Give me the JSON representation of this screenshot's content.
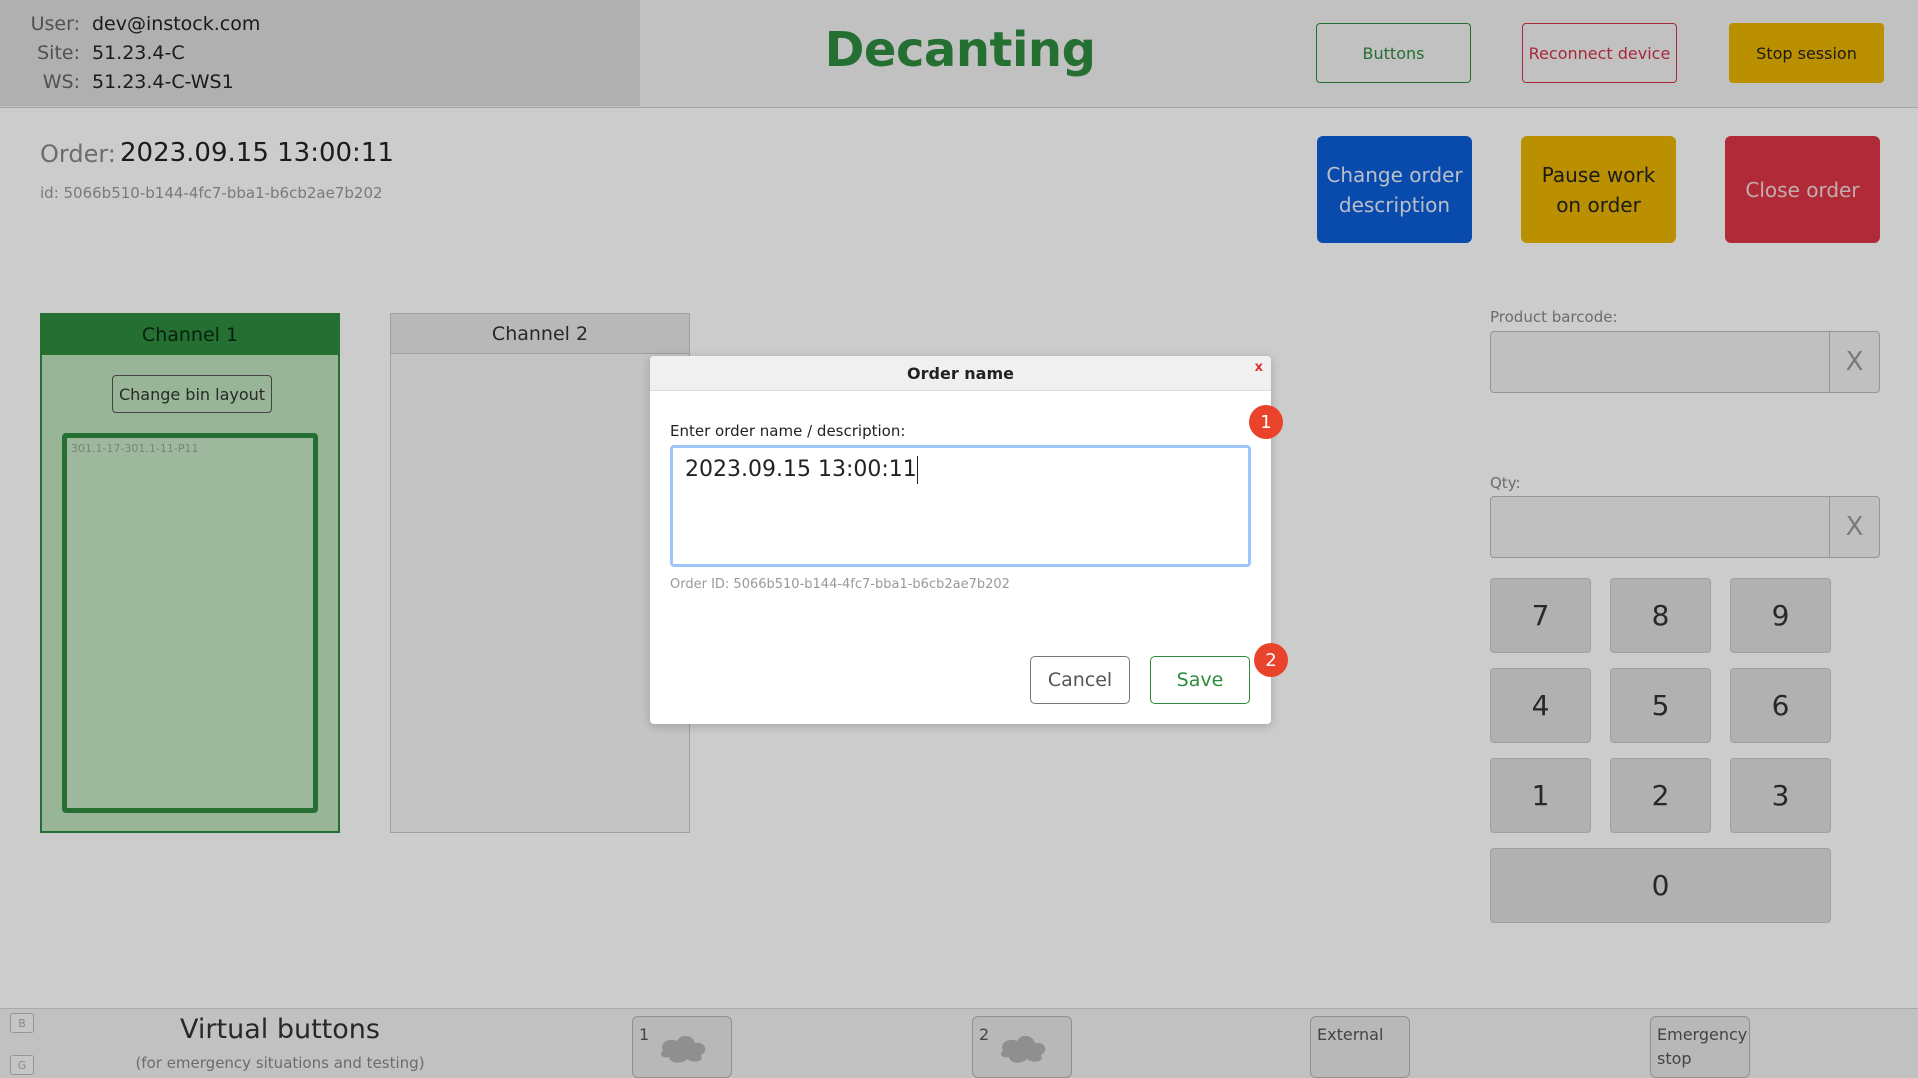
{
  "header": {
    "user_label": "User:",
    "user_value": "dev@instock.com",
    "site_label": "Site:",
    "site_value": "51.23.4-C",
    "ws_label": "WS:",
    "ws_value": "51.23.4-C-WS1",
    "title": "Decanting",
    "buttons_label": "Buttons",
    "reconnect_label": "Reconnect device",
    "stop_label": "Stop session"
  },
  "order": {
    "label": "Order:",
    "value": "2023.09.15 13:00:11",
    "id_text": "id: 5066b510-b144-4fc7-bba1-b6cb2ae7b202",
    "change_label": "Change order description",
    "pause_label": "Pause work on order",
    "close_label": "Close order"
  },
  "channels": [
    {
      "title": "Channel 1",
      "button_label": "Change bin layout",
      "bin_label": "301.1-17-301.1-11-P11"
    },
    {
      "title": "Channel 2"
    }
  ],
  "inputs": {
    "barcode_label": "Product barcode:",
    "qty_label": "Qty:",
    "clear_glyph": "X"
  },
  "numpad": [
    "7",
    "8",
    "9",
    "4",
    "5",
    "6",
    "1",
    "2",
    "3",
    "0"
  ],
  "footer": {
    "mini_keys": [
      "B",
      "G"
    ],
    "title": "Virtual buttons",
    "subtitle": "(for emergency situations and testing)",
    "buttons": [
      "1",
      "2",
      "External",
      "Emergency stop"
    ]
  },
  "modal": {
    "title": "Order name",
    "close_glyph": "x",
    "field_label": "Enter order name / description:",
    "field_value": "2023.09.15 13:00:11",
    "order_id_text": "Order ID: 5066b510-b144-4fc7-bba1-b6cb2ae7b202",
    "cancel_label": "Cancel",
    "save_label": "Save",
    "badges": [
      "1",
      "2"
    ]
  },
  "colors": {
    "brand_green": "#2e8b3e",
    "primary_blue": "#0b5ed7",
    "warning_yellow": "#e9b400",
    "danger_red": "#dc3545",
    "badge_red": "#e9432c"
  }
}
